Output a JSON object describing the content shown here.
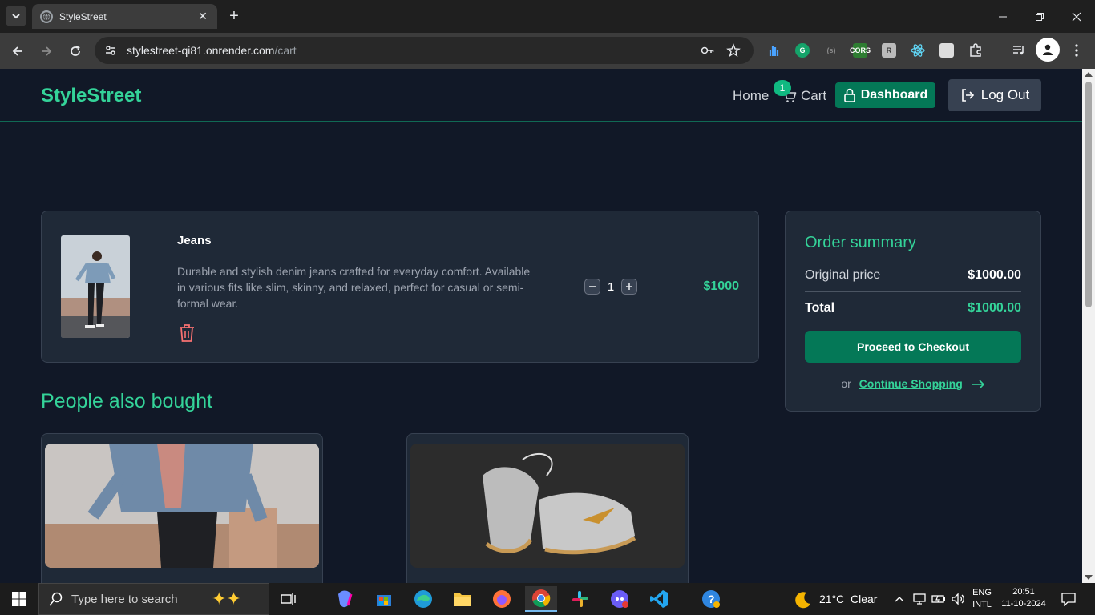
{
  "browser": {
    "tab_title": "StyleStreet",
    "url_host": "stylestreet-qi81.onrender.com",
    "url_path": "/cart"
  },
  "header": {
    "logo": "StyleStreet",
    "nav_home": "Home",
    "nav_cart": "Cart",
    "cart_count": "1",
    "dashboard_label": "Dashboard",
    "logout_label": "Log Out"
  },
  "cart": {
    "items": [
      {
        "name": "Jeans",
        "description": "Durable and stylish denim jeans crafted for everyday comfort. Available in various fits like slim, skinny, and relaxed, perfect for casual or semi-formal wear.",
        "quantity": "1",
        "price": "$1000"
      }
    ]
  },
  "summary": {
    "title": "Order summary",
    "original_price_label": "Original price",
    "original_price_value": "$1000.00",
    "total_label": "Total",
    "total_value": "$1000.00",
    "checkout_label": "Proceed to Checkout",
    "or_text": "or",
    "continue_label": "Continue Shopping"
  },
  "recommendations": {
    "title": "People also bought"
  },
  "taskbar": {
    "search_placeholder": "Type here to search",
    "weather_temp": "21°C",
    "weather_desc": "Clear",
    "lang_line1": "ENG",
    "lang_line2": "INTL",
    "time": "20:51",
    "date": "11-10-2024"
  },
  "colors": {
    "accent": "#34d399",
    "button_green": "#047857",
    "page_bg": "#111827",
    "card_bg": "#1f2937",
    "trash": "#f87171"
  }
}
